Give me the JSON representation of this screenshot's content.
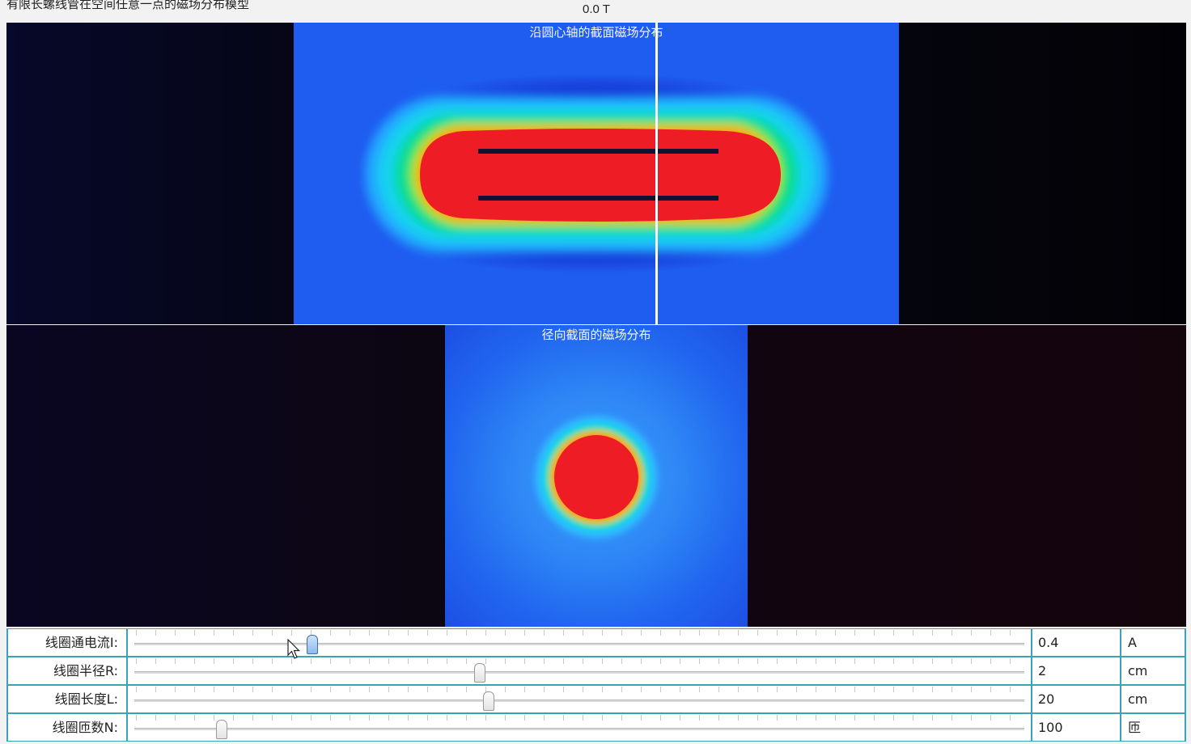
{
  "window": {
    "title": "有限长螺线管在空间任意一点的磁场分布模型"
  },
  "readout": {
    "field_value": "0.0 T"
  },
  "axial_view": {
    "caption": "沿圆心轴的截面磁场分布",
    "colormap": [
      "#1f5cf0",
      "#18c6ff",
      "#00e08a",
      "#e8e400",
      "#ff9a00",
      "#ee1c24"
    ]
  },
  "radial_view": {
    "caption": "径向截面的磁场分布",
    "colormap": [
      "#1f5cf0",
      "#18c6ff",
      "#00e08a",
      "#e8e400",
      "#ff9a00",
      "#ee1c24"
    ]
  },
  "controls": [
    {
      "label": "线圈通电流I:",
      "value": "0.4",
      "unit": "A",
      "position": 0.2,
      "active": true
    },
    {
      "label": "线圈半径R:",
      "value": "2",
      "unit": "cm",
      "position": 0.388,
      "active": false
    },
    {
      "label": "线圈长度L:",
      "value": "20",
      "unit": "cm",
      "position": 0.398,
      "active": false
    },
    {
      "label": "线圈匝数N:",
      "value": "100",
      "unit": "匝",
      "position": 0.098,
      "active": false
    }
  ],
  "colors": {
    "row_border": "#3aa3b8",
    "field_low": "#1f5cf0",
    "field_high": "#ee1c24",
    "coil": "#111133"
  }
}
